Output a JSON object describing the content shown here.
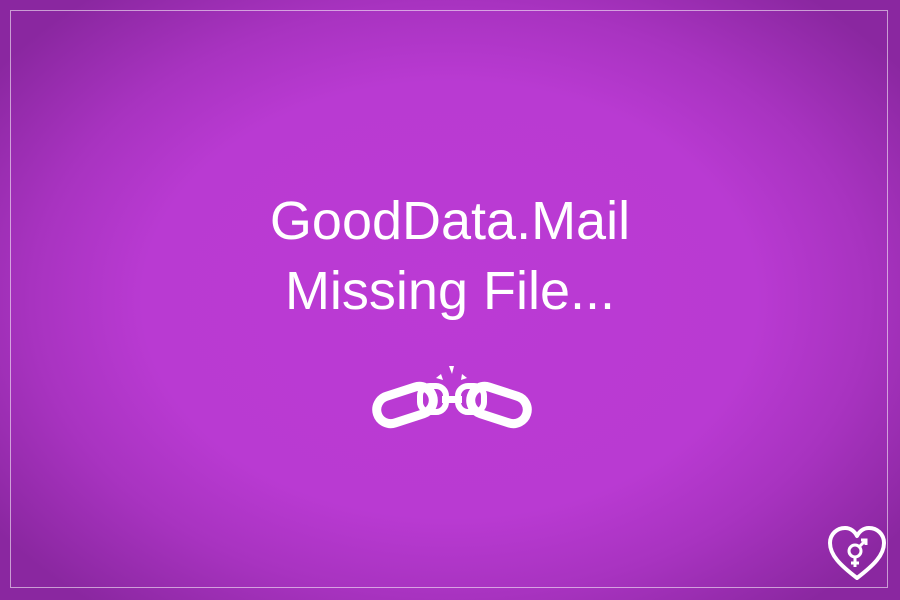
{
  "message": {
    "title": "GoodData.Mail",
    "subtitle": "Missing File..."
  },
  "icons": {
    "center": "broken-link-icon",
    "corner": "heart-gender-icon"
  },
  "colors": {
    "background": "#bb3ad4",
    "vignette": "#8a27a0",
    "text": "#ffffff",
    "frame": "#ffffff"
  }
}
